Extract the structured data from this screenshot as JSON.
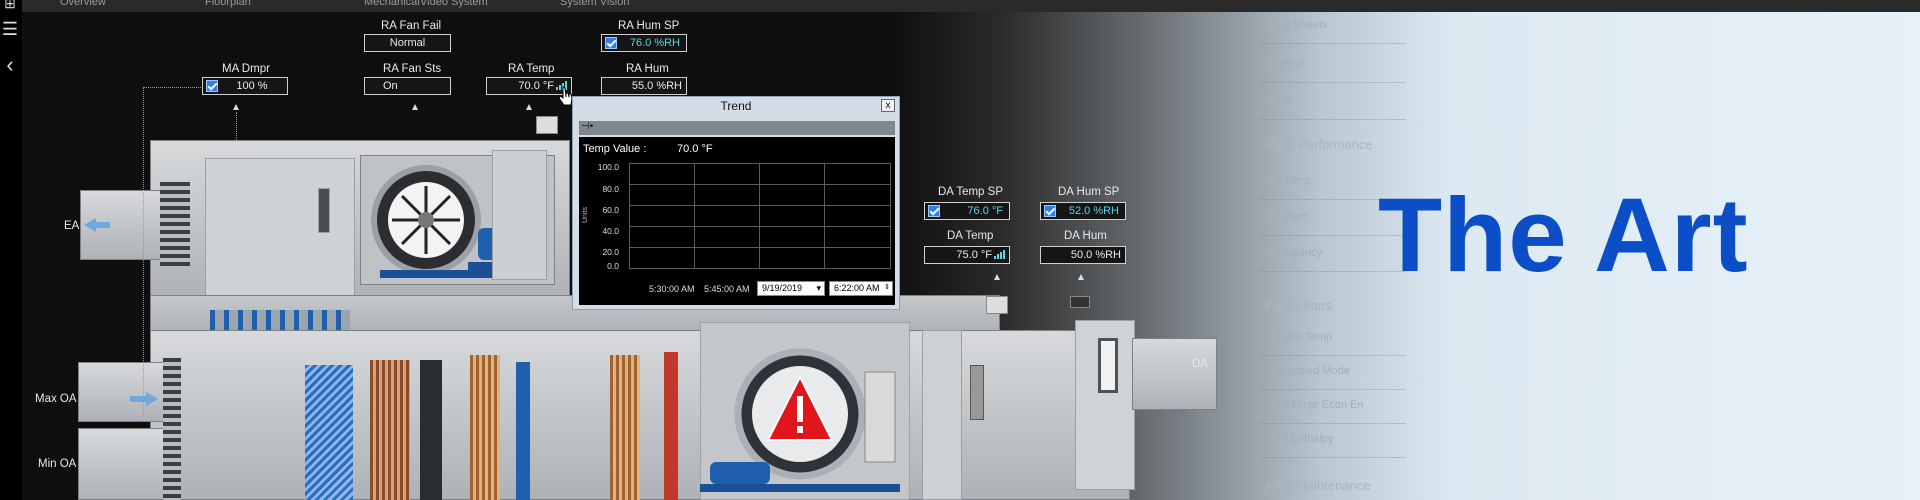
{
  "top_tabs": [
    "Overview",
    "Floorplan",
    "Mechanical",
    "Video System",
    "System Vision"
  ],
  "rail_icons": [
    "grid-icon",
    "menu-icon",
    "back-icon"
  ],
  "points": {
    "ma_dmpr": {
      "label": "MA Dmpr",
      "value": "100 %"
    },
    "ra_fan_fail": {
      "label": "RA Fan Fail",
      "value": "Normal"
    },
    "ra_fan_sts": {
      "label": "RA Fan Sts",
      "value": "On"
    },
    "ra_temp": {
      "label": "RA Temp",
      "value": "70.0 °F"
    },
    "ra_hum_sp": {
      "label": "RA Hum SP",
      "value": "76.0 %RH"
    },
    "ra_hum": {
      "label": "RA Hum",
      "value": "55.0 %RH"
    },
    "da_temp_sp": {
      "label": "DA Temp SP",
      "value": "76.0 °F"
    },
    "da_hum_sp": {
      "label": "DA Hum SP",
      "value": "52.0 %RH"
    },
    "da_temp": {
      "label": "DA Temp",
      "value": "75.0 °F"
    },
    "da_hum": {
      "label": "DA Hum",
      "value": "50.0 %RH"
    }
  },
  "duct_labels": {
    "ea": "EA",
    "max_oa": "Max OA",
    "min_oa": "Min OA",
    "da": "DA"
  },
  "trend": {
    "title": "Trend",
    "close": "x",
    "value_label": "Temp Value :",
    "value": "70.0 °F",
    "y_unit": "Units",
    "y_ticks": [
      "100.0",
      "80.0",
      "60.0",
      "40.0",
      "20.0",
      "0.0"
    ],
    "x_times": [
      "5:30:00 AM",
      "5:45:00 AM"
    ],
    "date_value": "9/19/2019",
    "time_value": "6:22:00 AM"
  },
  "sidebar": {
    "top_items": [
      "Data Sheets",
      "Legend",
      "SOO"
    ],
    "sections": [
      {
        "title": "Plant Performance",
        "items": [
          "DA Temp",
          "DA Hum",
          "Occupancy"
        ]
      },
      {
        "title": "Parameters",
        "items": [
          "Room Temp",
          "Occupied Mode",
          "MA Dmpr Econ En",
          "RA Enthalpy"
        ]
      },
      {
        "title": "AHU Maintenance",
        "items": []
      }
    ]
  },
  "headline": "The Art",
  "colors": {
    "setpoint_text": "#58d7e6",
    "headline": "#0b4ec7",
    "alarm": "#e0161d"
  }
}
